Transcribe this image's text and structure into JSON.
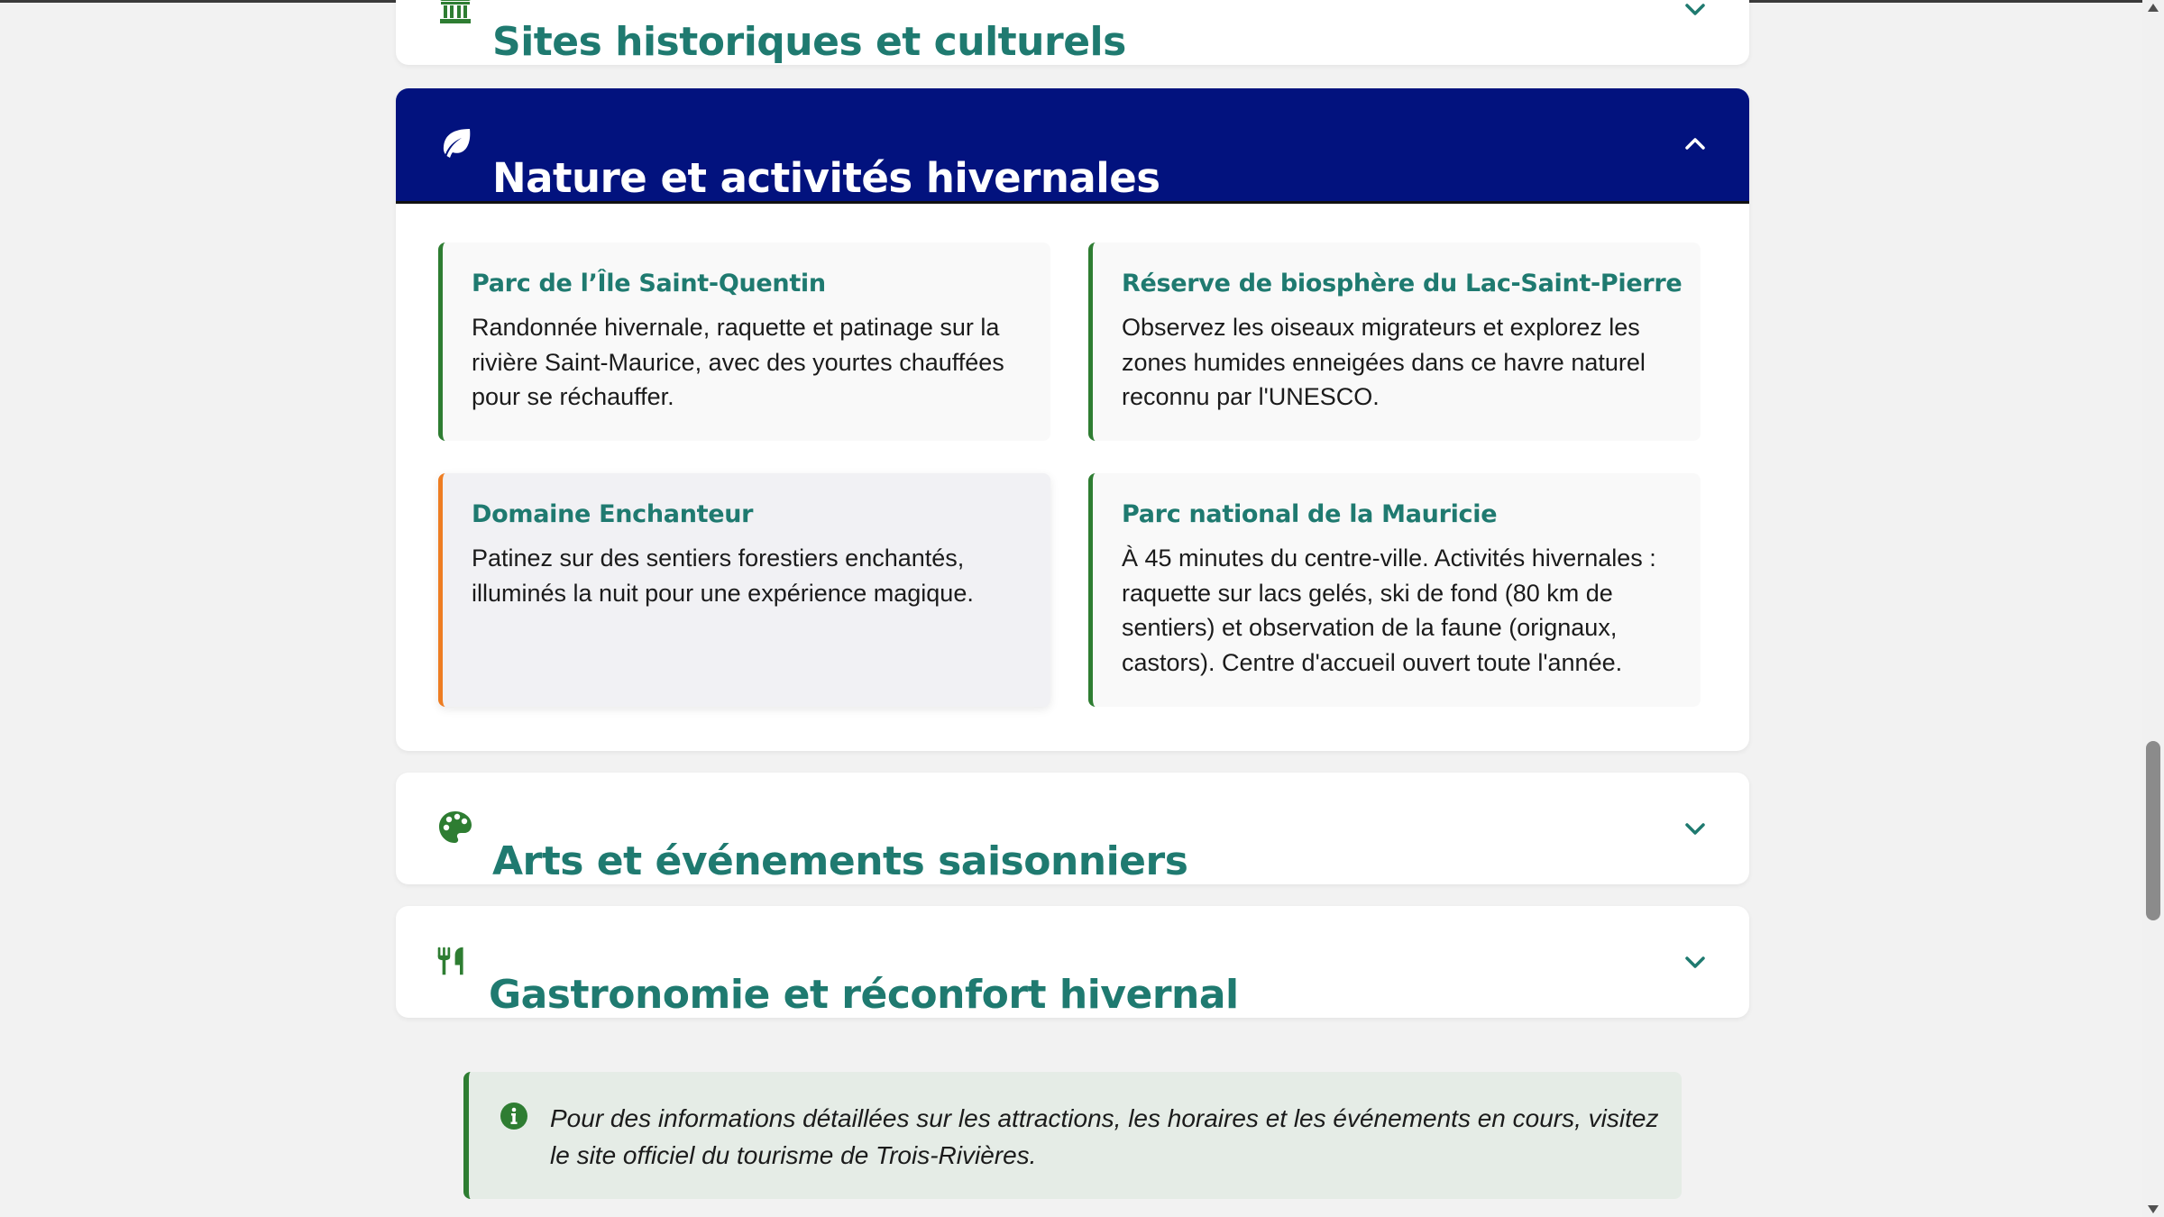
{
  "accordion": {
    "sites": {
      "title": "Sites historiques et culturels",
      "icon": "landmark-icon",
      "expanded": false
    },
    "nature": {
      "title": "Nature et activités hivernales",
      "icon": "leaf-icon",
      "expanded": true,
      "cards": [
        {
          "title": "Parc de l’Île Saint-Quentin",
          "text": "Randonnée hivernale, raquette et patinage sur la rivière Saint-Maurice, avec des yourtes chauffées pour se réchauffer."
        },
        {
          "title": "Réserve de biosphère du Lac-Saint-Pierre",
          "text": "Observez les oiseaux migrateurs et explorez les zones humides enneigées dans ce havre naturel reconnu par l'UNESCO."
        },
        {
          "title": "Domaine Enchanteur",
          "text": "Patinez sur des sentiers forestiers enchantés, illuminés la nuit pour une expérience magique."
        },
        {
          "title": "Parc national de la Mauricie",
          "text": "À 45 minutes du centre-ville. Activités hivernales : raquette sur lacs gelés, ski de fond (80 km de sentiers) et observation de la faune (orignaux, castors). Centre d'accueil ouvert toute l'année."
        }
      ]
    },
    "arts": {
      "title": "Arts et événements saisonniers",
      "icon": "palette-icon",
      "expanded": false
    },
    "gastro": {
      "title": "Gastronomie et réconfort hivernal",
      "icon": "utensils-icon",
      "expanded": false
    }
  },
  "info_note": {
    "icon": "info-circle-icon",
    "text": "Pour des informations détaillées sur les attractions, les horaires et les événements en cours, visitez le site officiel du tourisme de Trois-Rivières."
  },
  "colors": {
    "primary_green": "#1f7a70",
    "icon_green": "#2e7d32",
    "header_navy": "#02127e",
    "accent_orange": "#ee7d22"
  }
}
